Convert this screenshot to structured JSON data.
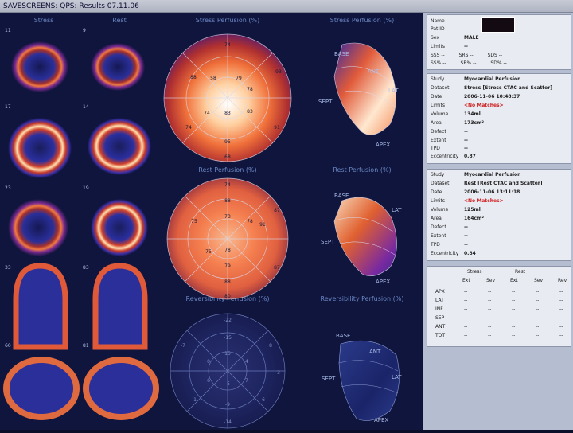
{
  "window": {
    "title": "SAVESCREENS: QPS: Results 07.11.06"
  },
  "slices": {
    "headers": {
      "stress": "Stress",
      "rest": "Rest"
    },
    "rows": [
      {
        "stress_num": "11",
        "rest_num": "9"
      },
      {
        "stress_num": "17",
        "rest_num": "14"
      },
      {
        "stress_num": "23",
        "rest_num": "19"
      },
      {
        "stress_num": "33",
        "rest_num": "83"
      },
      {
        "stress_num": "60",
        "rest_num": "81"
      }
    ]
  },
  "polar_maps": {
    "stress": {
      "title": "Stress Perfusion (%)",
      "values": [
        "74",
        "88",
        "93",
        "78",
        "58",
        "74",
        "83",
        "83",
        "74",
        "95",
        "68",
        "91",
        "79"
      ]
    },
    "rest": {
      "title": "Rest Perfusion (%)",
      "values": [
        "74",
        "88",
        "73",
        "75",
        "78",
        "91",
        "87",
        "75",
        "78",
        "79",
        "87",
        "88",
        "80"
      ]
    },
    "reversibility": {
      "title": "Reversibility Perfusion (%)",
      "values": [
        "-22",
        "-15",
        "-7",
        "8",
        "15",
        "0",
        "4",
        "6",
        "-5",
        "7",
        "-1",
        "-6",
        "-9",
        "-14",
        "3"
      ]
    }
  },
  "surface_views": {
    "stress": {
      "title": "Stress Perfusion (%)",
      "labels": {
        "base": "BASE",
        "ant": "ANT",
        "lat": "LAT",
        "sept": "SEPT",
        "apex": "APEX"
      }
    },
    "rest": {
      "title": "Rest Perfusion (%)",
      "labels": {
        "base": "BASE",
        "ant": "LAT",
        "lat": "LAT",
        "sept": "SEPT",
        "apex": "APEX"
      }
    },
    "reversibility": {
      "title": "Reversibility Perfusion (%)",
      "labels": {
        "base": "BASE",
        "ant": "ANT",
        "lat": "LAT",
        "sept": "SEPT",
        "apex": "APEX"
      }
    }
  },
  "patient": {
    "name_label": "Name",
    "patid_label": "Pat ID",
    "sex_label": "Sex",
    "sex_value": "MALE",
    "limits_label": "Limits",
    "limits_value": "--",
    "sss_label": "SSS",
    "sss_value": "--",
    "srs_label": "SRS",
    "srs_value": "--",
    "sds_label": "SDS",
    "sds_value": "--",
    "ss_pct_label": "SS%",
    "ss_pct_value": "--",
    "sr_pct_label": "SR%",
    "sr_pct_value": "--",
    "sd_pct_label": "SD%",
    "sd_pct_value": "--"
  },
  "stress_study": {
    "rows": [
      {
        "k": "Study",
        "v": "Myocardial Perfusion"
      },
      {
        "k": "Dataset",
        "v": "Stress [Stress CTAC and Scatter]"
      },
      {
        "k": "Date",
        "v": "2006-11-06 10:48:37"
      },
      {
        "k": "Limits",
        "v": "<No Matches>"
      },
      {
        "k": "Volume",
        "v": "134ml"
      },
      {
        "k": "Area",
        "v": "173cm²"
      },
      {
        "k": "Defect",
        "v": "--"
      },
      {
        "k": "Extent",
        "v": "--"
      },
      {
        "k": "TPD",
        "v": "--"
      },
      {
        "k": "Eccentricity",
        "v": "0.87"
      }
    ]
  },
  "rest_study": {
    "rows": [
      {
        "k": "Study",
        "v": "Myocardial Perfusion"
      },
      {
        "k": "Dataset",
        "v": "Rest [Rest CTAC and Scatter]"
      },
      {
        "k": "Date",
        "v": "2006-11-06 13:11:18"
      },
      {
        "k": "Limits",
        "v": "<No Matches>"
      },
      {
        "k": "Volume",
        "v": "125ml"
      },
      {
        "k": "Area",
        "v": "164cm²"
      },
      {
        "k": "Defect",
        "v": "--"
      },
      {
        "k": "Extent",
        "v": "--"
      },
      {
        "k": "TPD",
        "v": "--"
      },
      {
        "k": "Eccentricity",
        "v": "0.84"
      }
    ]
  },
  "score_table": {
    "group_headers": {
      "stress": "Stress",
      "rest": "Rest"
    },
    "columns": [
      "Ext",
      "Sev",
      "Ext",
      "Sev",
      "Rev"
    ],
    "rows": [
      {
        "label": "APX",
        "cells": [
          "--",
          "--",
          "--",
          "--",
          "--"
        ]
      },
      {
        "label": "LAT",
        "cells": [
          "--",
          "--",
          "--",
          "--",
          "--"
        ]
      },
      {
        "label": "INF",
        "cells": [
          "--",
          "--",
          "--",
          "--",
          "--"
        ]
      },
      {
        "label": "SEP",
        "cells": [
          "--",
          "--",
          "--",
          "--",
          "--"
        ]
      },
      {
        "label": "ANT",
        "cells": [
          "--",
          "--",
          "--",
          "--",
          "--"
        ]
      },
      {
        "label": "TOT",
        "cells": [
          "--",
          "--",
          "--",
          "--",
          "--"
        ]
      }
    ]
  }
}
